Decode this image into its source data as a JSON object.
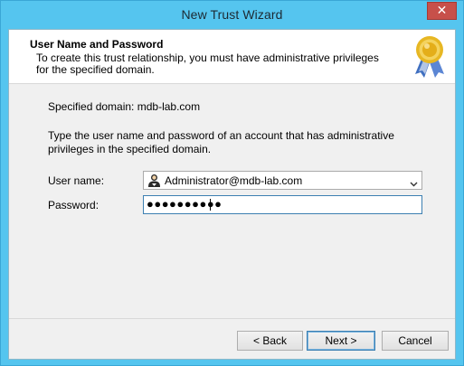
{
  "window": {
    "title": "New Trust Wizard",
    "close_label": "✕"
  },
  "header": {
    "title": "User Name and Password",
    "description": "To create this trust relationship, you must have administrative privileges for the specified domain."
  },
  "body": {
    "specified_domain": "Specified domain: mdb-lab.com",
    "instructions": "Type the user name and password of an account that has administrative privileges in the specified domain."
  },
  "form": {
    "username_label": "User name:",
    "username_value": "Administrator@mdb-lab.com",
    "password_label": "Password:",
    "password_value": "●●●●●●●●●●"
  },
  "buttons": {
    "back": "< Back",
    "next": "Next >",
    "cancel": "Cancel"
  },
  "colors": {
    "titlebar": "#55c5ef",
    "close": "#c7504a",
    "focus_border": "#3c7fb1"
  },
  "icons": {
    "header": "award-ribbon-icon",
    "user": "user-icon",
    "dropdown": "chevron-down-icon"
  }
}
